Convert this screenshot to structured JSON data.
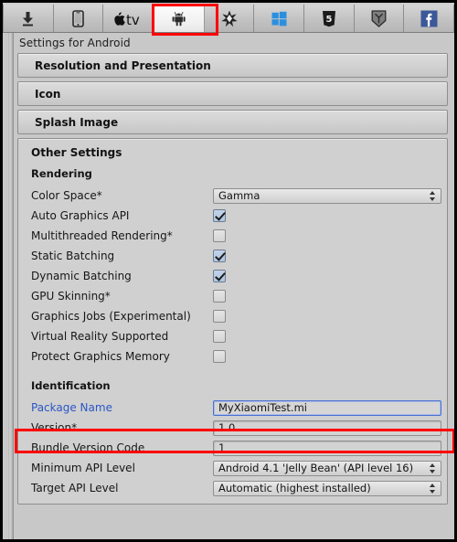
{
  "tabbar": {
    "tabs": [
      {
        "name": "standalone",
        "icon": "download-arrow-icon",
        "selected": false
      },
      {
        "name": "ios",
        "icon": "iphone-icon",
        "selected": false
      },
      {
        "name": "tvos",
        "icon": "apple-tv-icon",
        "selected": false
      },
      {
        "name": "android",
        "icon": "android-robot-icon",
        "selected": true
      },
      {
        "name": "tizen",
        "icon": "tizen-icon",
        "selected": false
      },
      {
        "name": "windows-store",
        "icon": "windows-logo-icon",
        "selected": false
      },
      {
        "name": "webgl",
        "icon": "html5-shield-icon",
        "selected": false
      },
      {
        "name": "samsung-tv",
        "icon": "samsung-tv-icon",
        "selected": false
      },
      {
        "name": "facebook",
        "icon": "facebook-f-icon",
        "selected": false
      }
    ],
    "selected_index": 3
  },
  "panel": {
    "title": "Settings for Android"
  },
  "foldouts": [
    {
      "label": "Resolution and Presentation"
    },
    {
      "label": "Icon"
    },
    {
      "label": "Splash Image"
    }
  ],
  "other_settings": {
    "title": "Other Settings",
    "rendering": {
      "group_label": "Rendering",
      "color_space": {
        "label": "Color Space*",
        "value": "Gamma"
      },
      "checkboxes": [
        {
          "label": "Auto Graphics API",
          "checked": true
        },
        {
          "label": "Multithreaded Rendering*",
          "checked": false
        },
        {
          "label": "Static Batching",
          "checked": true
        },
        {
          "label": "Dynamic Batching",
          "checked": true
        },
        {
          "label": "GPU Skinning*",
          "checked": false
        },
        {
          "label": "Graphics Jobs (Experimental)",
          "checked": false
        },
        {
          "label": "Virtual Reality Supported",
          "checked": false
        },
        {
          "label": "Protect Graphics Memory",
          "checked": false
        }
      ]
    },
    "identification": {
      "group_label": "Identification",
      "package_name": {
        "label": "Package Name",
        "value": "MyXiaomiTest.mi",
        "highlighted": true
      },
      "version": {
        "label": "Version*",
        "value": "1.0"
      },
      "bundle_version_code": {
        "label": "Bundle Version Code",
        "value": "1"
      },
      "minimum_api_level": {
        "label": "Minimum API Level",
        "value": "Android 4.1 'Jelly Bean' (API level 16)"
      },
      "target_api_level": {
        "label": "Target API Level",
        "value": "Automatic (highest installed)"
      }
    }
  },
  "annotations": {
    "highlight_color": "#ff0000",
    "boxes": [
      {
        "name": "android-tab-highlight"
      },
      {
        "name": "package-name-highlight"
      }
    ]
  }
}
